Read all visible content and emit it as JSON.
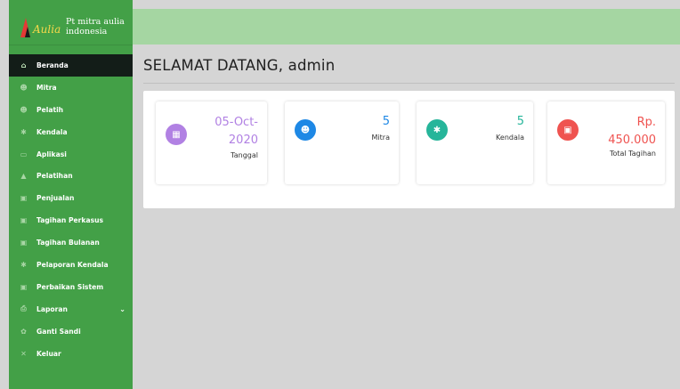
{
  "brand": {
    "line1": "Pt mitra aulia",
    "line2": "indonesia",
    "logo_script": "Aulia"
  },
  "page_title": "SELAMAT DATANG, admin",
  "nav": [
    {
      "label": "Beranda",
      "icon": "home-icon",
      "glyph": "⌂",
      "active": true
    },
    {
      "label": "Mitra",
      "icon": "users-icon",
      "glyph": "☻"
    },
    {
      "label": "Pelatih",
      "icon": "users-icon",
      "glyph": "☻"
    },
    {
      "label": "Kendala",
      "icon": "bug-icon",
      "glyph": "✱"
    },
    {
      "label": "Aplikasi",
      "icon": "laptop-icon",
      "glyph": "▭"
    },
    {
      "label": "Pelatihan",
      "icon": "graduation-cap-icon",
      "glyph": "▲"
    },
    {
      "label": "Penjualan",
      "icon": "money-icon",
      "glyph": "▣"
    },
    {
      "label": "Tagihan Perkasus",
      "icon": "money-icon",
      "glyph": "▣"
    },
    {
      "label": "Tagihan Bulanan",
      "icon": "money-icon",
      "glyph": "▣"
    },
    {
      "label": "Pelaporan Kendala",
      "icon": "bug-icon",
      "glyph": "✱"
    },
    {
      "label": "Perbaikan Sistem",
      "icon": "money-icon",
      "glyph": "▣"
    },
    {
      "label": "Laporan",
      "icon": "print-icon",
      "glyph": "⎙",
      "caret": "⌄"
    },
    {
      "label": "Ganti Sandi",
      "icon": "gear-icon",
      "glyph": "✿"
    },
    {
      "label": "Keluar",
      "icon": "close-icon",
      "glyph": "✕"
    }
  ],
  "cards": [
    {
      "value_line1": "05-Oct-",
      "value_line2": "2020",
      "label": "Tanggal",
      "icon": "calendar-icon",
      "glyph": "▦",
      "color": "#b181e3",
      "value_color": "#b181e3"
    },
    {
      "value_line1": "5",
      "label": "Mitra",
      "icon": "users-icon",
      "glyph": "☻",
      "color": "#1e88e5",
      "value_color": "#1e88e5"
    },
    {
      "value_line1": "5",
      "label": "Kendala",
      "icon": "bug-icon",
      "glyph": "✱",
      "color": "#26b59a",
      "value_color": "#26b59a"
    },
    {
      "value_line1": "Rp.",
      "value_line2": "450.000",
      "label": "Total Tagihan",
      "icon": "money-icon",
      "glyph": "▣",
      "color": "#ef5350",
      "value_color": "#ef5350"
    }
  ]
}
